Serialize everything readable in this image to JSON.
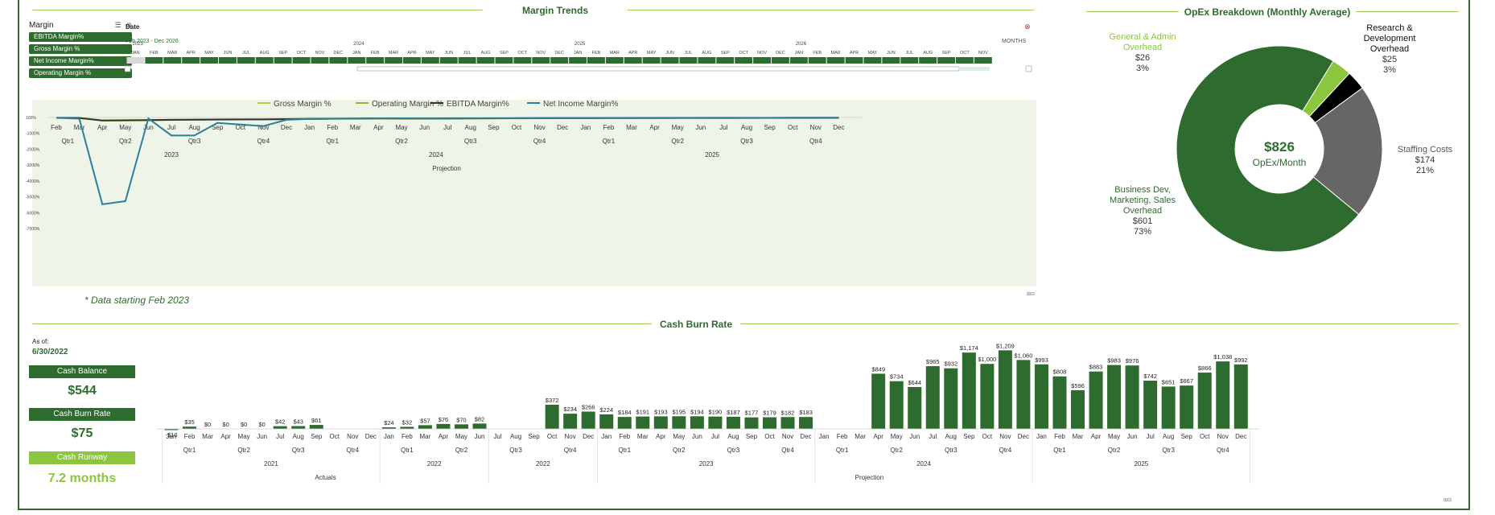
{
  "margin_trends": {
    "title": "Margin Trends",
    "slicer": {
      "header": "Margin",
      "items": [
        "EBITDA Margin%",
        "Gross Margin %",
        "Net Income Margin%",
        "Operating Margin %"
      ]
    },
    "timeline": {
      "label": "Date",
      "range": "Feb 2023 - Dec 2026",
      "level": "MONTHS",
      "years": [
        "2023",
        "2024",
        "2025",
        "2026"
      ],
      "months_2023": [
        "JAN",
        "FEB",
        "MAR",
        "APR",
        "MAY",
        "JUN",
        "JUL",
        "AUG",
        "SEP",
        "OCT",
        "NOV",
        "DEC"
      ],
      "months_repeat": [
        "JAN",
        "FEB",
        "MAR",
        "APR",
        "MAY",
        "JUN",
        "JUL",
        "AUG",
        "SEP",
        "OCT",
        "NOV",
        "DEC"
      ]
    },
    "note": "* Data starting Feb 2023"
  },
  "chart_data": [
    {
      "type": "line",
      "legend_position": "top",
      "series": [
        {
          "name": "Gross Margin %",
          "color": "#b5cf3c"
        },
        {
          "name": "Operating Margin %",
          "color": "#8fbc2f"
        },
        {
          "name": "EBITDA Margin%",
          "color": "#333333"
        },
        {
          "name": "Net Income Margin%",
          "color": "#2a7f9a"
        }
      ],
      "months": [
        "Feb",
        "Mar",
        "Apr",
        "May",
        "Jun",
        "Jul",
        "Aug",
        "Sep",
        "Oct",
        "Nov",
        "Dec",
        "Jan",
        "Feb",
        "Mar",
        "Apr",
        "May",
        "Jun",
        "Jul",
        "Aug",
        "Sep",
        "Oct",
        "Nov",
        "Dec",
        "Jan",
        "Feb",
        "Mar",
        "Apr",
        "May",
        "Jun",
        "Jul",
        "Aug",
        "Sep",
        "Oct",
        "Nov",
        "Dec"
      ],
      "quarters": [
        "Qtr1",
        "Qtr2",
        "Qtr3",
        "Qtr4",
        "Qtr1",
        "Qtr2",
        "Qtr3",
        "Qtr4",
        "Qtr1",
        "Qtr2",
        "Qtr3",
        "Qtr4"
      ],
      "years": [
        "2023",
        "2024",
        "2025"
      ],
      "phase": "Projection",
      "y_ticks": [
        "100%",
        "-1000%",
        "-2000%",
        "-3000%",
        "-4000%",
        "-5000%",
        "-6000%",
        "-7000%"
      ],
      "net_income_values": [
        80,
        20,
        -5450,
        -5250,
        40,
        -1050,
        -1050,
        -250,
        -350,
        -450,
        -50,
        10,
        20,
        30,
        40,
        50,
        45,
        30,
        40,
        45,
        50,
        55,
        60,
        55,
        60,
        65,
        60,
        70,
        65,
        60,
        70,
        75,
        80,
        85,
        90
      ],
      "gross_values": [
        90,
        80,
        -80,
        -70,
        -60,
        -40,
        -30,
        -20,
        -15,
        -10,
        5,
        20,
        30,
        40,
        50,
        45,
        40,
        50,
        55,
        60,
        65,
        70,
        72,
        74,
        76,
        78,
        80,
        82,
        84,
        85,
        86,
        87,
        88,
        89,
        90
      ]
    },
    {
      "type": "pie",
      "title": "OpEx Breakdown (Monthly Average)",
      "center_value": "$826",
      "center_label": "OpEx/Month",
      "slices": [
        {
          "name": "General & Admin Overhead",
          "value": 26,
          "value_label": "$26",
          "pct_label": "3%",
          "color": "#8cc63f"
        },
        {
          "name": "Research & Development Overhead",
          "value": 25,
          "value_label": "$25",
          "pct_label": "3%",
          "color": "#000000"
        },
        {
          "name": "Staffing Costs",
          "value": 174,
          "value_label": "$174",
          "pct_label": "21%",
          "color": "#666666"
        },
        {
          "name": "Business Dev, Marketing, Sales Overhead",
          "value": 601,
          "value_label": "$601",
          "pct_label": "73%",
          "color": "#2e6b2e"
        }
      ]
    },
    {
      "type": "bar",
      "title": "Cash Burn Rate",
      "values": [
        -10,
        35,
        0,
        0,
        0,
        0,
        42,
        43,
        61,
        null,
        null,
        null,
        24,
        32,
        57,
        76,
        70,
        82,
        null,
        null,
        null,
        372,
        234,
        266,
        224,
        184,
        191,
        193,
        195,
        194,
        190,
        187,
        177,
        179,
        182,
        183,
        null,
        null,
        null,
        849,
        734,
        644,
        965,
        932,
        1174,
        1000,
        1209,
        1060,
        993,
        808,
        596,
        883,
        983,
        976,
        742,
        651,
        667,
        866,
        1038,
        992
      ],
      "labels": [
        "-$10",
        "$35",
        "$0",
        "$0",
        "$0",
        "$0",
        "$42",
        "$43",
        "$61",
        "",
        "",
        "",
        "$24",
        "$32",
        "$57",
        "$76",
        "$70",
        "$82",
        "",
        "",
        "",
        "$372",
        "$234",
        "$266",
        "$224",
        "$184",
        "$191",
        "$193",
        "$195",
        "$194",
        "$190",
        "$187",
        "$177",
        "$179",
        "$182",
        "$183",
        "",
        "",
        "",
        "$849",
        "$734",
        "$644",
        "$965",
        "$932",
        "$1,174",
        "$1,000",
        "$1,209",
        "$1,060",
        "$993",
        "$808",
        "$596",
        "$883",
        "$983",
        "$976",
        "$742",
        "$651",
        "$667",
        "$866",
        "$1,038",
        "$992"
      ],
      "months": [
        "Jan",
        "Feb",
        "Mar",
        "Apr",
        "May",
        "Jun",
        "Jul",
        "Aug",
        "Sep",
        "Oct",
        "Nov",
        "Dec"
      ],
      "quarter_labels": [
        "Qtr1",
        "Qtr2",
        "Qtr3",
        "Qtr4"
      ],
      "years": [
        "2021",
        "2022",
        "2022",
        "2023",
        "2024",
        "2025"
      ],
      "phases": [
        "Actuals",
        "Projection"
      ],
      "ylim": [
        0,
        1300
      ],
      "color": "#2e6b2e"
    }
  ],
  "cash": {
    "title": "Cash Burn Rate",
    "as_of_label": "As of:",
    "as_of_date": "6/30/2022",
    "balance_label": "Cash Balance",
    "balance_value": "$544",
    "burn_label": "Cash Burn Rate",
    "burn_value": "$75",
    "runway_label": "Cash Runway",
    "runway_value": "7.2 months"
  },
  "colors": {
    "accent": "#2e6b2e",
    "light_accent": "#8cc63f",
    "plot_bg": "#eef5e8"
  }
}
